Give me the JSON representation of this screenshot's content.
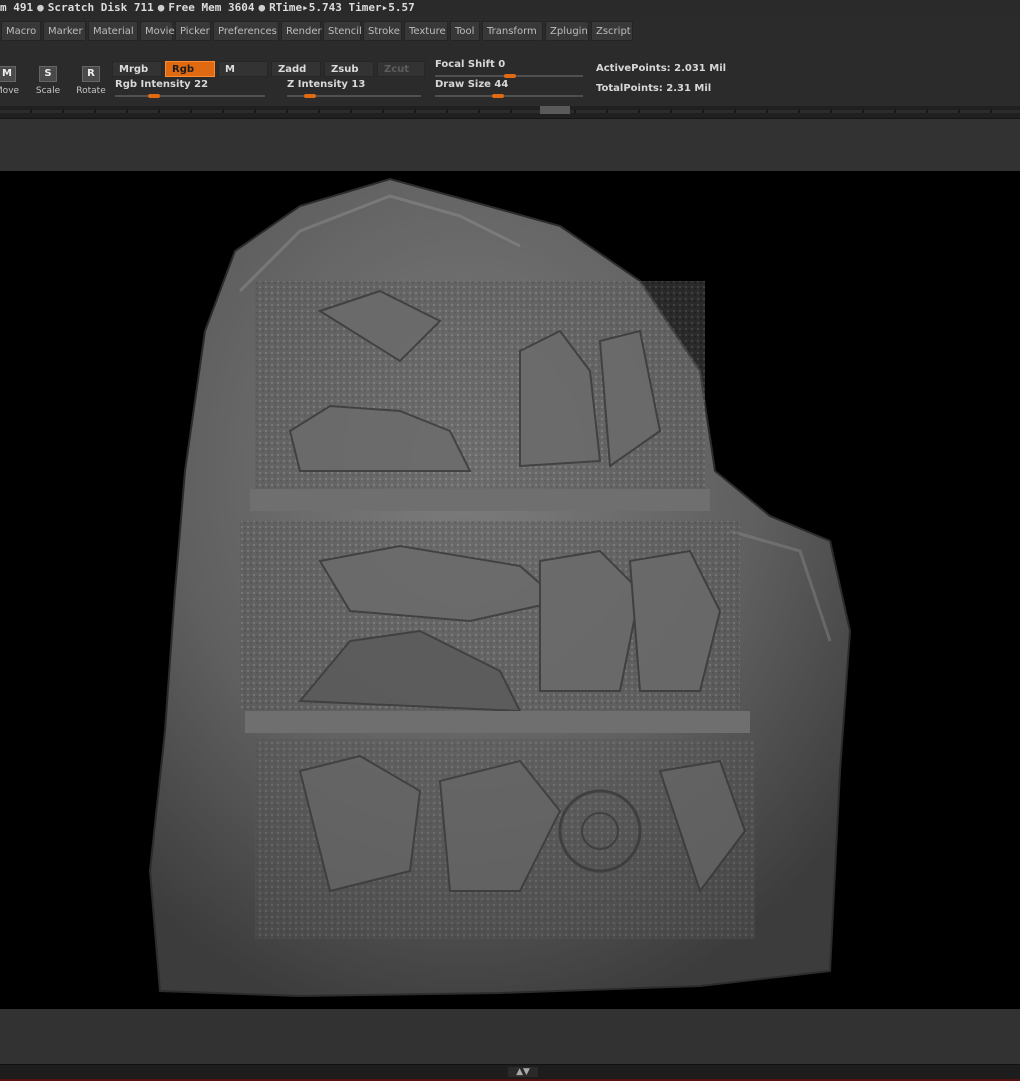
{
  "status": {
    "mem": "m 491",
    "scratch": "Scratch Disk 711",
    "free_mem": "Free Mem 3604",
    "rtime": "RTime▸5.743",
    "timer": "Timer▸5.57",
    "dot": "●"
  },
  "menubar": {
    "items": [
      "Macro",
      "Marker",
      "Material",
      "Movie",
      "Picker",
      "Preferences",
      "Render",
      "Stencil",
      "Stroke",
      "Texture",
      "Tool",
      "Transform",
      "Zplugin",
      "Zscript"
    ]
  },
  "toolbar": {
    "move": {
      "icon": "M",
      "label": "Move"
    },
    "scale": {
      "icon": "S",
      "label": "Scale"
    },
    "rotate": {
      "icon": "R",
      "label": "Rotate"
    },
    "mrgb": "Mrgb",
    "rgb": "Rgb",
    "m": "M",
    "zadd": "Zadd",
    "zsub": "Zsub",
    "zcut": "Zcut",
    "rgb_intensity": {
      "label": "Rgb Intensity 22",
      "value": 22
    },
    "z_intensity": {
      "label": "Z Intensity 13",
      "value": 13
    },
    "focal_shift": {
      "label": "Focal Shift 0",
      "value": 0
    },
    "draw_size": {
      "label": "Draw Size 44",
      "value": 44
    },
    "active_points": "ActivePoints: 2.031 Mil",
    "total_points": "TotalPoints: 2.31 Mil"
  },
  "colors": {
    "accent": "#e06a12",
    "background": "#2b2b2b",
    "viewport": "#000000",
    "stone": "#6e6e6e"
  },
  "icons": [
    "move-icon",
    "scale-icon",
    "rotate-icon",
    "collapse-arrow-icon"
  ]
}
